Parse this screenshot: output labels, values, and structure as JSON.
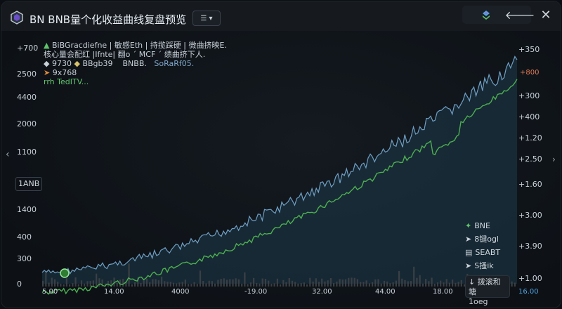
{
  "window": {
    "title": "BN BNB量个化收益曲线复盘预览",
    "view_toggle_label": "☰",
    "close_label": "✕",
    "toolbar_icons": [
      "layers-icon",
      "back-arrow-icon"
    ]
  },
  "legend": {
    "line1": "BiBGracdiefne | 敏感Eth | 持揽踩硬 | 微曲挤映E.",
    "line2": "核心量会配红 |Ifnte| 翻o ˊ MCF ˊ 绩曲挤下人.",
    "row3": [
      {
        "marker": "9730",
        "text": "BBgb39",
        "color": "#d9c36a"
      },
      {
        "marker": "BNBB.",
        "text": "SoRaRf05.",
        "color": "#7fa6c8"
      }
    ],
    "row4": "9x768",
    "row5": "rrh TedITV..."
  },
  "asset_box": "1ANB",
  "y_left_labels": [
    "+700",
    "2500",
    "4400",
    "2000",
    "1100",
    "1ANB",
    "1400",
    "400",
    "300",
    "0"
  ],
  "y_right_labels": [
    "+350",
    "+300",
    "+400",
    "+1.20",
    "+2.50",
    "+1.60",
    "+3.00",
    "+3.90",
    "+1.00"
  ],
  "x_labels": [
    "5.00",
    "14.00",
    "4000",
    "-19.00",
    "32.00",
    "44.00",
    "18.00",
    "16.00"
  ],
  "price_tag": "+800",
  "bottom_legend": [
    {
      "icon": "diamond-green-icon",
      "label": "BNE"
    },
    {
      "icon": "arrow-icon",
      "label": "8键ogl"
    },
    {
      "icon": "bars-icon",
      "label": "SEABT"
    },
    {
      "icon": "arrow-icon",
      "label": "S搔ik"
    }
  ],
  "export_button": {
    "line1": "↓ 拨滚和塘",
    "line2": "1oeg"
  },
  "colors": {
    "equity_line": "#6f9fc4",
    "benchmark_line": "#4caf50",
    "area_fill": "#1d3a4a",
    "volume_bars": "#3a3f45",
    "accent_orange": "#e27a54"
  }
}
